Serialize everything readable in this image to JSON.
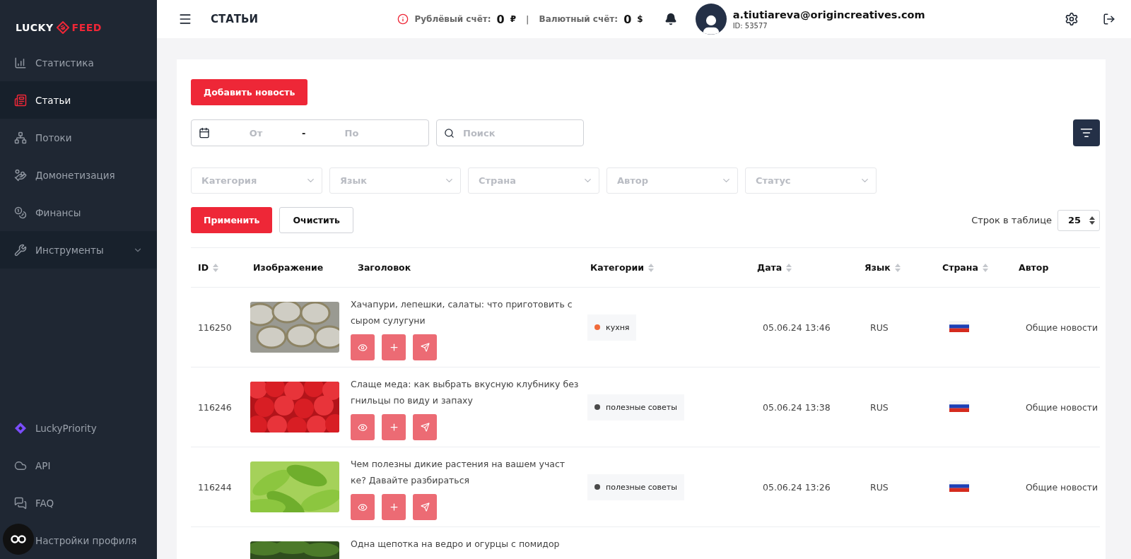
{
  "sidebar": {
    "logo": {
      "left": "LUCKY",
      "right": "FEED"
    },
    "items": [
      {
        "label": "Статистика",
        "kind": "link",
        "selected": false
      },
      {
        "label": "Статьи",
        "kind": "link",
        "selected": true
      },
      {
        "label": "Потоки",
        "kind": "link",
        "selected": false
      },
      {
        "label": "Домонетизация",
        "kind": "link",
        "selected": false
      },
      {
        "label": "Финансы",
        "kind": "link",
        "selected": false
      },
      {
        "label": "Инструменты",
        "kind": "group",
        "selected": false
      }
    ],
    "bottom_items": [
      {
        "label": "LuckyPriority"
      },
      {
        "label": "API"
      },
      {
        "label": "FAQ"
      },
      {
        "label": "Настройки профиля"
      }
    ]
  },
  "header": {
    "title": "СТАТЬИ",
    "balances": [
      {
        "label": "Рублёвый счёт:",
        "amount": "0",
        "currency": "₽"
      },
      {
        "label": "Валютный счёт:",
        "amount": "0",
        "currency": "$"
      }
    ],
    "separator": "|",
    "user": {
      "email": "a.tiutiareva@origincreatives.com",
      "id": "ID: 53577"
    }
  },
  "toolbar": {
    "add_button": "Добавить новость",
    "date_from": {
      "placeholder": "От"
    },
    "date_dash": "-",
    "date_to": {
      "placeholder": "По"
    },
    "search": {
      "placeholder": "Поиск"
    }
  },
  "filters": [
    {
      "placeholder": "Категория"
    },
    {
      "placeholder": "Язык"
    },
    {
      "placeholder": "Страна"
    },
    {
      "placeholder": "Автор"
    },
    {
      "placeholder": "Статус"
    }
  ],
  "apply_button": "Применить",
  "clear_button": "Очистить",
  "rows_per_page": {
    "label": "Строк в таблице",
    "value": "25"
  },
  "table": {
    "columns": [
      {
        "label": "ID",
        "sortable": true
      },
      {
        "label": "Изображение",
        "sortable": false
      },
      {
        "label": "Заголовок",
        "sortable": false
      },
      {
        "label": "Категории",
        "sortable": true
      },
      {
        "label": "Дата",
        "sortable": true
      },
      {
        "label": "Язык",
        "sortable": true
      },
      {
        "label": "Страна",
        "sortable": true
      },
      {
        "label": "Автор",
        "sortable": false
      }
    ],
    "rows": [
      {
        "id": "116250",
        "title": "Хачапури, лепешки, салаты: что приготовить с сыром сулугуни",
        "category": {
          "label": "кухня",
          "color": "#f06a3a"
        },
        "date": "05.06.24 13:46",
        "language": "RUS",
        "author": "Общие новости"
      },
      {
        "id": "116246",
        "title": "Слаще меда: как выбрать вкусную клубнику без гнильцы по виду и запаху",
        "category": {
          "label": "полезные советы",
          "color": "#4a4a4a"
        },
        "date": "05.06.24 13:38",
        "language": "RUS",
        "author": "Общие новости"
      },
      {
        "id": "116244",
        "title": "Чем полезны дикие растения на вашем участ ке? Давайте разбираться",
        "category": {
          "label": "полезные советы",
          "color": "#4a4a4a"
        },
        "date": "05.06.24 13:26",
        "language": "RUS",
        "author": "Общие новости"
      },
      {
        "title": "Одна щепотка на ведро и огурцы с помидор"
      }
    ]
  }
}
